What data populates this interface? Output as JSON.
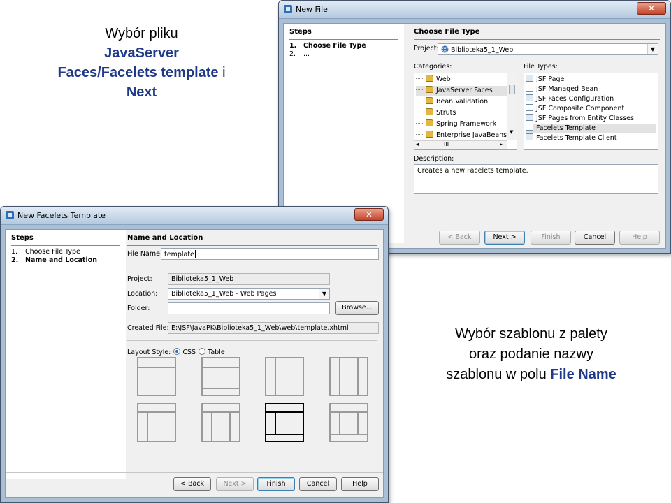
{
  "caption_top": {
    "line1": "Wybór pliku",
    "hl1": "JavaServer",
    "hl2": "Faces/Facelets template",
    "tail2": " i",
    "hl3": "Next"
  },
  "caption_bottom": {
    "line1": "Wybór szablonu z palety",
    "line2": "oraz podanie nazwy",
    "line3_pre": "szablonu w polu ",
    "hl": "File Name"
  },
  "new_file": {
    "title": "New File",
    "steps_header": "Steps",
    "steps": [
      {
        "num": "1.",
        "label": "Choose File Type"
      },
      {
        "num": "2.",
        "label": "..."
      }
    ],
    "panel_title": "Choose File Type",
    "project_label": "Project:",
    "project_value": "Biblioteka5_1_Web",
    "categories_label": "Categories:",
    "categories": [
      "Web",
      "JavaServer Faces",
      "Bean Validation",
      "Struts",
      "Spring Framework",
      "Enterprise JavaBeans"
    ],
    "file_types_label": "File Types:",
    "file_types": [
      "JSF Page",
      "JSF Managed Bean",
      "JSF Faces Configuration",
      "JSF Composite Component",
      "JSF Pages from Entity Classes",
      "Facelets Template",
      "Facelets Template Client"
    ],
    "description_label": "Description:",
    "description": "Creates a new Facelets template.",
    "buttons": {
      "back": "< Back",
      "next": "Next >",
      "finish": "Finish",
      "cancel": "Cancel",
      "help": "Help"
    },
    "hscroll_label": "III"
  },
  "new_facelets": {
    "title": "New Facelets Template",
    "steps_header": "Steps",
    "steps": [
      {
        "num": "1.",
        "label": "Choose File Type"
      },
      {
        "num": "2.",
        "label": "Name and Location"
      }
    ],
    "panel_title": "Name and Location",
    "file_name_label": "File Name:",
    "file_name_value": "template",
    "project_label": "Project:",
    "project_value": "Biblioteka5_1_Web",
    "location_label": "Location:",
    "location_value": "Biblioteka5_1_Web - Web Pages",
    "folder_label": "Folder:",
    "folder_value": "",
    "browse": "Browse...",
    "created_label": "Created File:",
    "created_value": "E:\\JSF\\JavaPK\\Biblioteka5_1_Web\\web\\template.xhtml",
    "layout_label": "Layout Style:",
    "css_label": "CSS",
    "table_label": "Table",
    "buttons": {
      "back": "< Back",
      "next": "Next >",
      "finish": "Finish",
      "cancel": "Cancel",
      "help": "Help"
    }
  }
}
